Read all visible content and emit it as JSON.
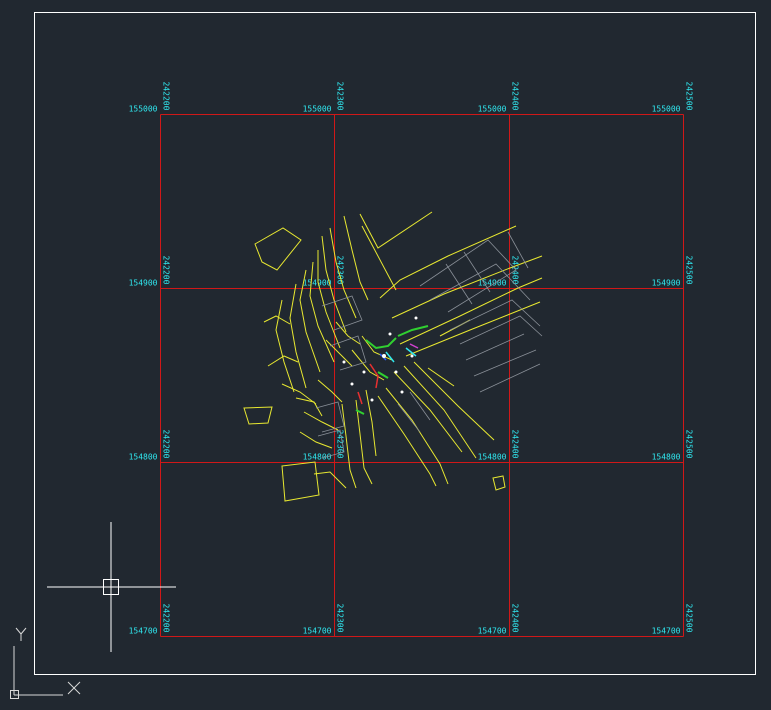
{
  "colors": {
    "background": "#212830",
    "frame": "#ffffff",
    "grid_lines": "#d01818",
    "grid_labels": "#30e8f0",
    "drawing_primary": "#e8e830",
    "drawing_secondary": "#9aa0a8",
    "crosshair": "#ffffff",
    "ucs": "#d8d8d8"
  },
  "grid": {
    "northings": [
      "155000",
      "154900",
      "154800",
      "154700"
    ],
    "eastings": [
      "242200",
      "242300",
      "242400",
      "242500"
    ]
  },
  "ucs": {
    "x_label": "X",
    "y_label": "Y"
  }
}
